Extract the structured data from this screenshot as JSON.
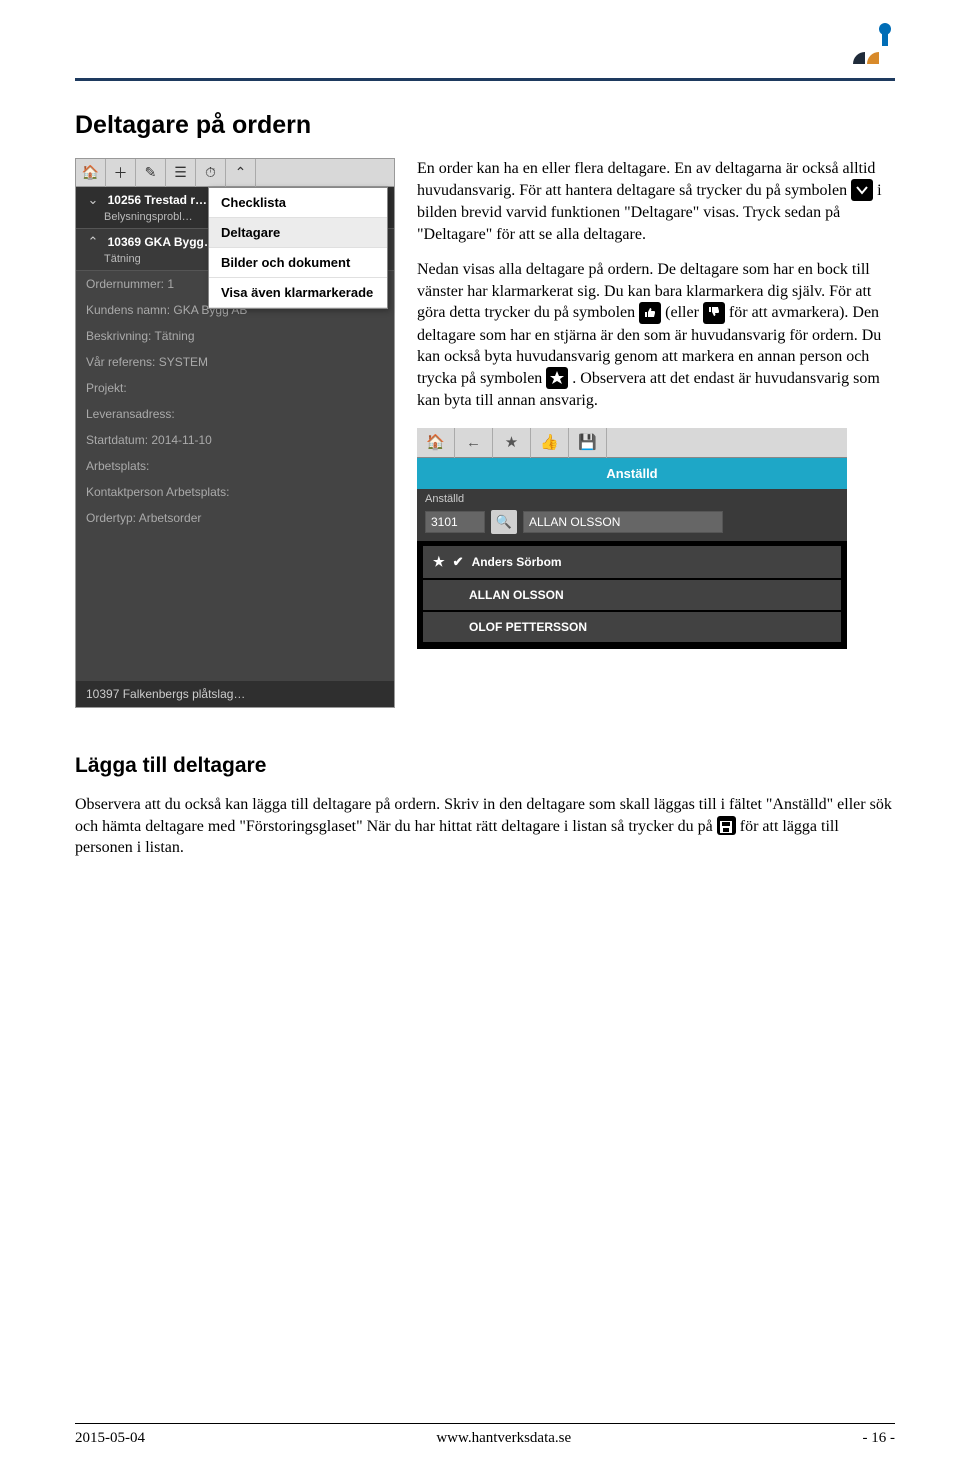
{
  "logo": {
    "colors": {
      "blue": "#006db6",
      "orange": "#d88a2a",
      "dark": "#1f2b3a"
    }
  },
  "h1": "Deltagare på ordern",
  "h2": "Lägga till deltagare",
  "body": {
    "p1a": "En order kan ha en eller flera deltagare. En av deltagarna är också alltid huvudansvarig. För att hantera deltagare så trycker du på symbolen ",
    "p1b": " i bilden brevid varvid funktionen \"Deltagare\" visas. Tryck sedan på \"Deltagare\" för att se alla deltagare.",
    "p2a": "Nedan visas alla deltagare på ordern. De deltagare som har en bock till vänster har klarmarkerat sig. Du kan bara klarmarkera dig själv. För att göra detta trycker du på symbolen ",
    "p2b": " (eller ",
    "p2c": " för att avmarkera). Den deltagare som har en stjärna är den som är huvudansvarig för ordern. Du kan också byta huvudansvarig genom att markera en annan person och trycka på symbolen ",
    "p2d": ". Observera att det endast är huvudansvarig som kan byta till annan ansvarig."
  },
  "lower": {
    "p1a": "Observera att du också kan lägga till deltagare på ordern. Skriv in den deltagare som skall läggas till i fältet \"Anställd\" eller sök och hämta deltagare med \"Förstoringsglaset\" När du har hittat rätt deltagare i listan så trycker du på ",
    "p1b": " för att lägga till personen i listan."
  },
  "ss1": {
    "orders": [
      {
        "id": "10256 Trestad r…",
        "sub": "Belysningsprobl…"
      },
      {
        "id": "10369 GKA Bygg…",
        "sub": "Tätning"
      }
    ],
    "fields": {
      "ordernummer": "Ordernummer: 1",
      "kundnamn": "Kundens namn: GKA Bygg AB",
      "beskrivning": "Beskrivning: Tätning",
      "referens": "Vår referens: SYSTEM",
      "projekt": "Projekt:",
      "leveransadress": "Leveransadress:",
      "startdatum": "Startdatum: 2014-11-10",
      "arbetsplats": "Arbetsplats:",
      "kontaktperson": "Kontaktperson Arbetsplats:",
      "ordertyp": "Ordertyp: Arbetsorder"
    },
    "popup": [
      "Checklista",
      "Deltagare",
      "Bilder och dokument",
      "Visa även klarmarkerade"
    ],
    "bottom": "10397 Falkenbergs plåtslag…"
  },
  "ss2": {
    "header": "Anställd",
    "form_label": "Anställd",
    "code": "3101",
    "name": "ALLAN OLSSON",
    "rows": [
      {
        "star": true,
        "check": true,
        "name": "Anders Sörbom"
      },
      {
        "star": false,
        "check": false,
        "name": "ALLAN OLSSON"
      },
      {
        "star": false,
        "check": false,
        "name": "OLOF PETTERSSON"
      }
    ]
  },
  "footer": {
    "date": "2015-05-04",
    "url": "www.hantverksdata.se",
    "page": "- 16 -"
  }
}
